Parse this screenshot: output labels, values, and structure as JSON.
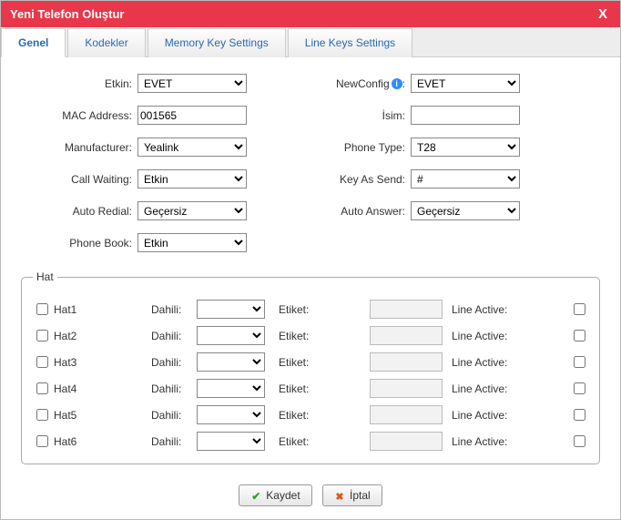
{
  "title": "Yeni Telefon Oluştur",
  "close_label": "X",
  "tabs": {
    "genel": "Genel",
    "kodekler": "Kodekler",
    "memkey": "Memory Key Settings",
    "linekeys": "Line Keys Settings"
  },
  "form": {
    "etkin_label": "Etkin:",
    "etkin_value": "EVET",
    "newconfig_label": "NewConfig",
    "newconfig_colon": ":",
    "newconfig_value": "EVET",
    "mac_label": "MAC Address:",
    "mac_value": "001565",
    "isim_label": "İsim:",
    "isim_value": "",
    "manufacturer_label": "Manufacturer:",
    "manufacturer_value": "Yealink",
    "phonetype_label": "Phone Type:",
    "phonetype_value": "T28",
    "callwaiting_label": "Call Waiting:",
    "callwaiting_value": "Etkin",
    "keyassend_label": "Key As Send:",
    "keyassend_value": "#",
    "autoredial_label": "Auto Redial:",
    "autoredial_value": "Geçersiz",
    "autoanswer_label": "Auto Answer:",
    "autoanswer_value": "Geçersiz",
    "phonebook_label": "Phone Book:",
    "phonebook_value": "Etkin"
  },
  "hat": {
    "legend": "Hat",
    "dahili_label": "Dahili:",
    "etiket_label": "Etiket:",
    "lineactive_label": "Line Active:",
    "rows": [
      {
        "name": "Hat1"
      },
      {
        "name": "Hat2"
      },
      {
        "name": "Hat3"
      },
      {
        "name": "Hat4"
      },
      {
        "name": "Hat5"
      },
      {
        "name": "Hat6"
      }
    ]
  },
  "buttons": {
    "save": "Kaydet",
    "cancel": "İptal"
  }
}
